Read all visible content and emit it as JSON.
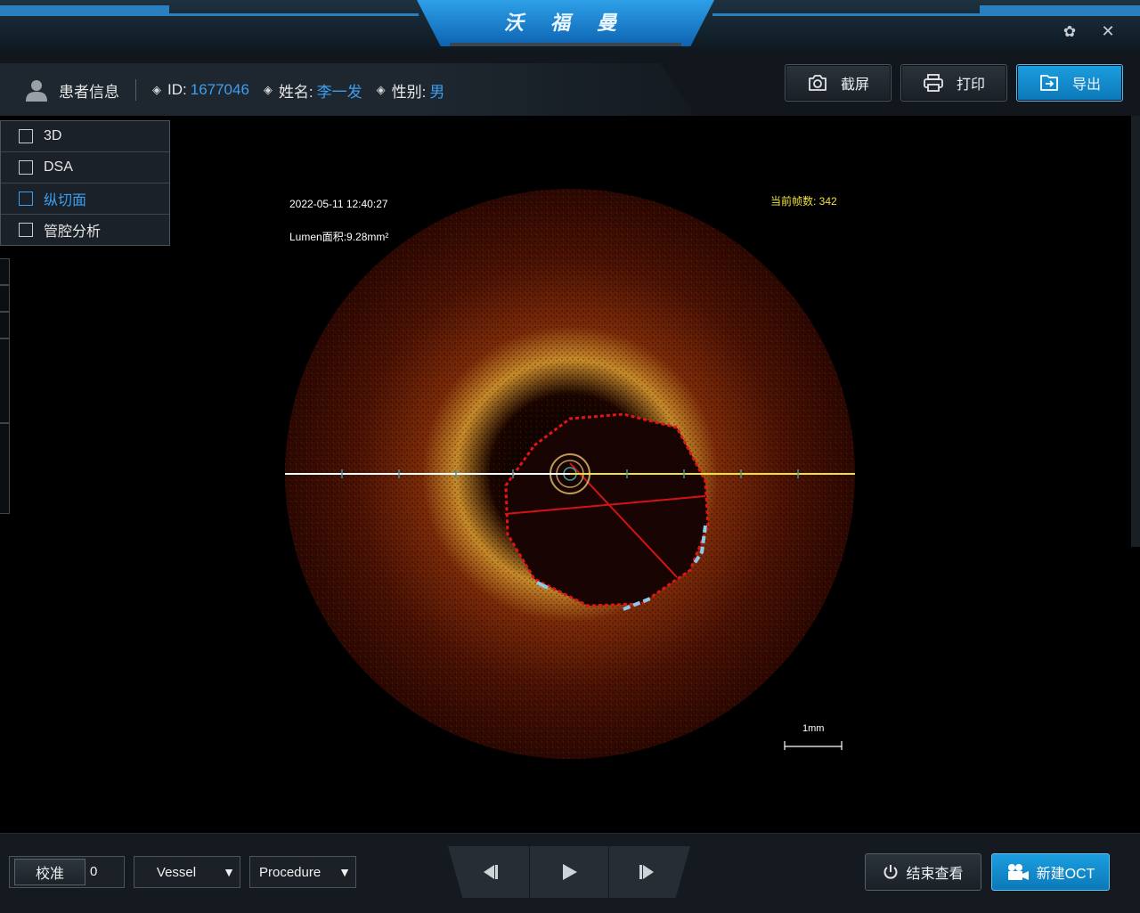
{
  "app": {
    "brand": "沃 福 曼"
  },
  "window_controls": {
    "settings_icon": "gear-icon",
    "close_icon": "close-icon",
    "close_label": "✕",
    "settings_label": "✿"
  },
  "patient": {
    "title": "患者信息",
    "id_label": "ID:",
    "id_value": "1677046",
    "name_label": "姓名:",
    "name_value": "李一发",
    "sex_label": "性别:",
    "sex_value": "男"
  },
  "toolbar": {
    "screenshot_label": "截屏",
    "print_label": "打印",
    "export_label": "导出"
  },
  "options": [
    {
      "label": "3D",
      "checked": false,
      "active": false
    },
    {
      "label": "DSA",
      "checked": false,
      "active": false
    },
    {
      "label": "纵切面",
      "checked": false,
      "active": true
    },
    {
      "label": "管腔分析",
      "checked": false,
      "active": false
    }
  ],
  "image": {
    "timestamp": "2022-05-11 12:40:27",
    "lumen_area": "Lumen面积:9.28mm²",
    "frame_label": "当前帧数: 342",
    "scale_label": "1mm"
  },
  "bottom": {
    "calibrate_label": "校准",
    "calibrate_value": "0",
    "vessel_label": "Vessel",
    "procedure_label": "Procedure",
    "end_label": "结束查看",
    "new_label": "新建OCT"
  },
  "colors": {
    "accent": "#3d9ef0",
    "primary_button": "#0c78b8",
    "lumen_contour": "#d41414",
    "calcium_marker": "#8fc9e8",
    "frame_text": "#f0e03a"
  }
}
